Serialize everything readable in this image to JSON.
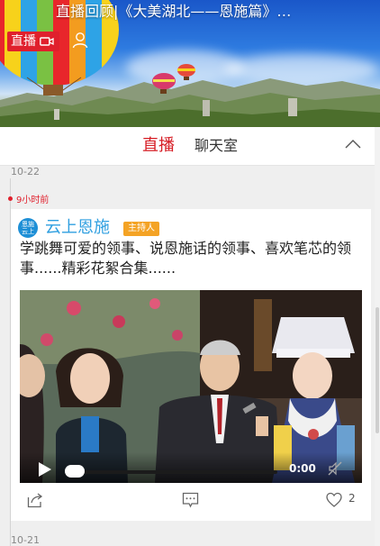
{
  "banner": {
    "title": "直播回顾|《大美湖北——恩施篇》…",
    "live_label": "直播",
    "live_icon": "video-camera-icon",
    "user_icon": "user-icon"
  },
  "tabs": [
    {
      "label": "直播",
      "active": true
    },
    {
      "label": "聊天室",
      "active": false
    }
  ],
  "timeline": {
    "dates": [
      "10-22",
      "10-21"
    ],
    "time_ago": "9小时前"
  },
  "post": {
    "avatar_text_1": "恩施",
    "avatar_text_2": "云上",
    "author": "云上恩施",
    "badge": "主持人",
    "text": "学跳舞可爱的领事、说恩施话的领事、喜欢笔芯的领事......精彩花絮合集......",
    "video": {
      "time": "0:00",
      "progress": 0
    },
    "likes": "2"
  },
  "colors": {
    "accent": "#d61c24",
    "author": "#2f9fe0",
    "badge": "#f4a325"
  }
}
